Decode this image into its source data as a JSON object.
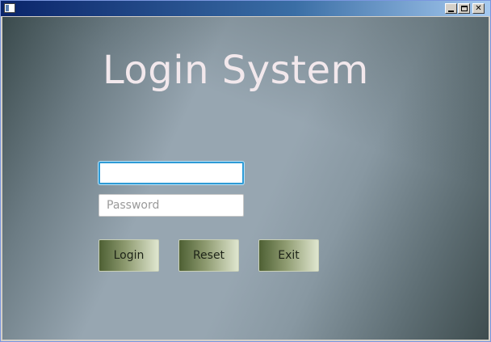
{
  "window": {
    "title": "",
    "controls": {
      "minimize_icon": "minimize-icon",
      "maximize_icon": "maximize-icon",
      "close_glyph": "✕"
    }
  },
  "login": {
    "title": "Login System",
    "username": {
      "value": "",
      "placeholder": ""
    },
    "password": {
      "value": "",
      "placeholder": "Password"
    },
    "buttons": {
      "login": "Login",
      "reset": "Reset",
      "exit": "Exit"
    }
  },
  "colors": {
    "title_text": "#f2e8ec",
    "focus_border": "#2e9bd6",
    "button_dark": "#4e6034",
    "button_light": "#dfe6cf"
  }
}
